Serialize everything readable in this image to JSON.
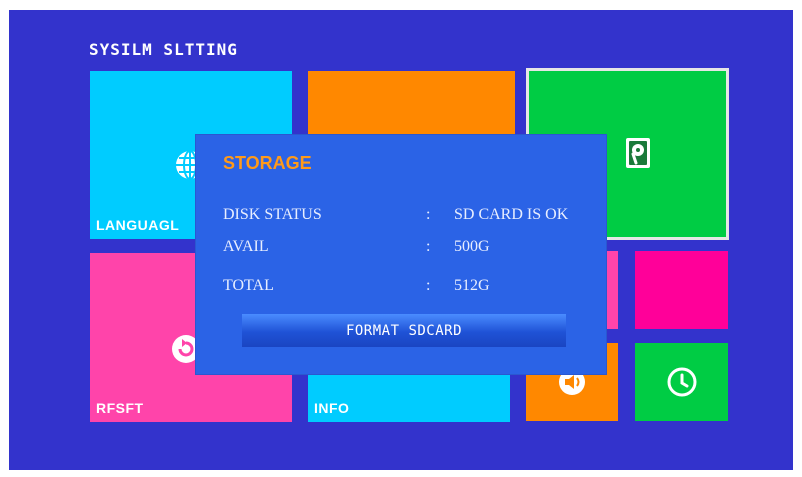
{
  "screen": {
    "title": "SYSILM SLTTING",
    "background": "#3333cc"
  },
  "tiles": {
    "language": {
      "label": "LANGUAGL",
      "color": "#00ccff",
      "icon": "globe-icon"
    },
    "top_middle": {
      "color": "#ff8800"
    },
    "storage": {
      "color": "#00cc44",
      "icon": "hard-disk-icon"
    },
    "reset": {
      "label": "RFSFT",
      "color": "#ff44aa",
      "icon": "reset-icon"
    },
    "info": {
      "label": "INFO",
      "color": "#00ccff"
    },
    "pink_small": {
      "color": "#ff44aa"
    },
    "magenta_small": {
      "color": "#ff0099"
    },
    "sound": {
      "color": "#ff8800",
      "icon": "speaker-icon"
    },
    "clock": {
      "color": "#00cc44",
      "icon": "clock-icon"
    }
  },
  "storage_dialog": {
    "title": "STORAGE",
    "rows": [
      {
        "label": "DISK STATUS",
        "separator": ":",
        "value": "SD CARD IS OK"
      },
      {
        "label": "AVAIL",
        "separator": ":",
        "value": "500G"
      },
      {
        "label": "TOTAL",
        "separator": ":",
        "value": "512G"
      }
    ],
    "format_button": "FORMAT SDCARD",
    "title_color": "#ff9a1a"
  }
}
